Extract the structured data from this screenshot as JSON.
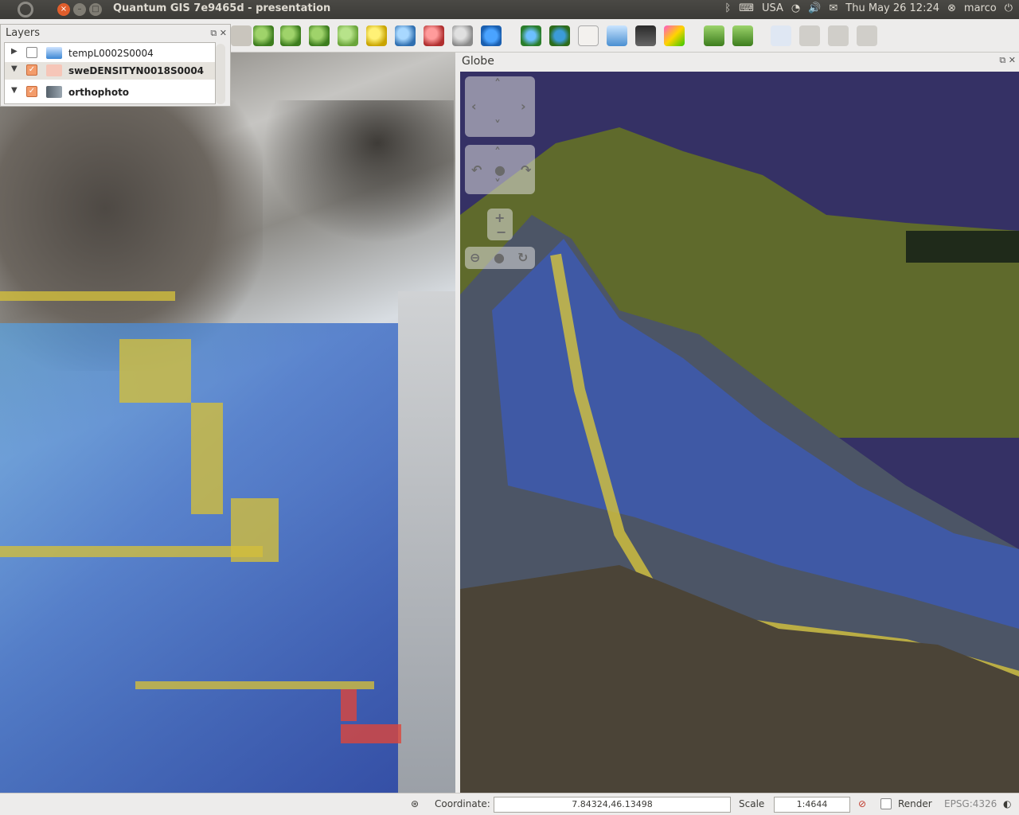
{
  "window": {
    "title": "Quantum GIS 7e9465d - presentation"
  },
  "topbar": {
    "keyboard": "USA",
    "datetime": "Thu May 26 12:24",
    "user": "marco"
  },
  "layers_panel": {
    "title": "Layers",
    "items": [
      {
        "label": "tempL0002S0004",
        "checked": false,
        "expanded": false
      },
      {
        "label": "sweDENSITYN0018S0004",
        "checked": true,
        "expanded": true,
        "selected": true
      },
      {
        "label": "orthophoto",
        "checked": true,
        "expanded": true
      }
    ]
  },
  "globe_panel": {
    "title": "Globe"
  },
  "statusbar": {
    "coordinate_label": "Coordinate:",
    "coordinate_value": "7.84324,46.13498",
    "scale_label": "Scale",
    "scale_value": "1:4644",
    "render_label": "Render",
    "crs": "EPSG:4326"
  },
  "toolbar_icons": [
    "pan-icon",
    "zoom-in-icon",
    "zoom-out-icon",
    "zoom-full-icon",
    "zoom-layer-icon",
    "zoom-selection-icon",
    "zoom-last-icon",
    "zoom-next-icon",
    "refresh-icon",
    "globe-icon",
    "earth-icon",
    "scatter-icon",
    "dna-icon",
    "layers-icon",
    "plugin-icon",
    "tool-a-icon",
    "tool-b-icon",
    "label-icon",
    "pin-icon",
    "wrench-a-icon",
    "wrench-b-icon"
  ]
}
